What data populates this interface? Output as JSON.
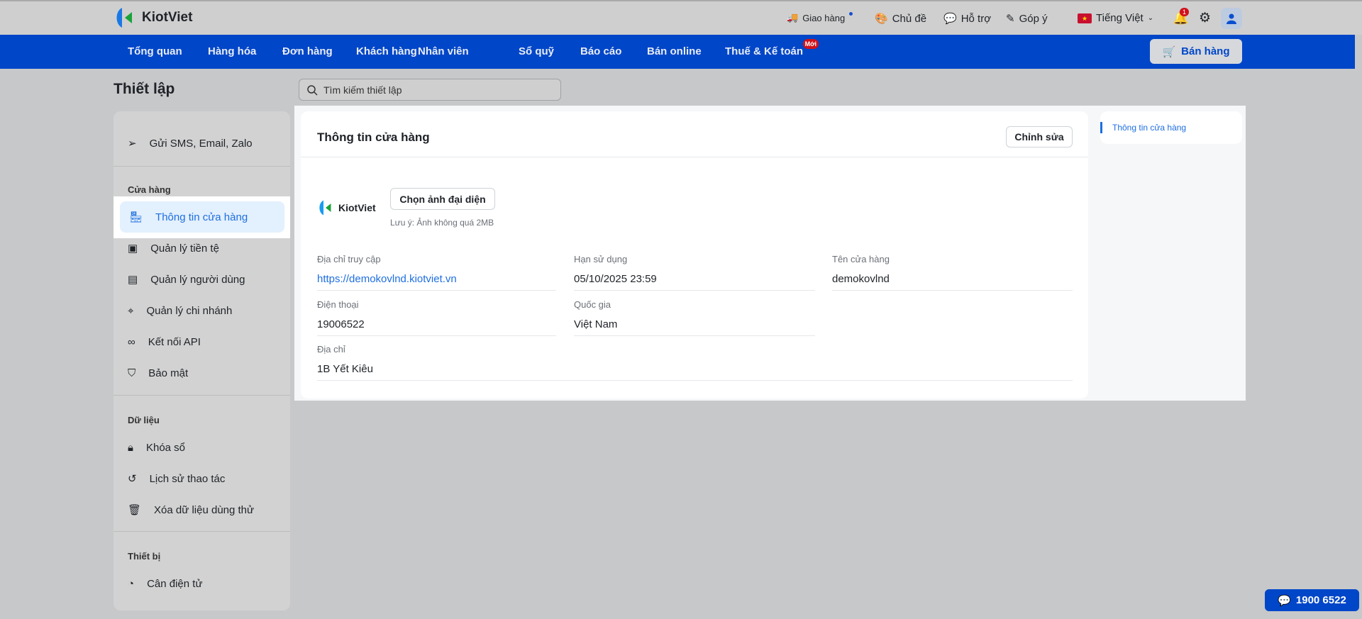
{
  "header": {
    "brand": "KiotViet",
    "delivery": "Giao hàng",
    "theme": "Chủ đề",
    "support": "Hỗ trợ",
    "feedback": "Góp ý",
    "language": "Tiếng Việt",
    "notification_count": "1"
  },
  "nav": {
    "items": [
      "Tổng quan",
      "Hàng hóa",
      "Đơn hàng",
      "Khách hàng",
      "Nhân viên",
      "Sổ quỹ",
      "Báo cáo",
      "Bán online",
      "Thuế & Kế toán"
    ],
    "new_badge": "Mới",
    "sell_button": "Bán hàng"
  },
  "page": {
    "title": "Thiết lập",
    "search_placeholder": "Tìm kiếm thiết lập"
  },
  "sidebar": {
    "top_item": "Gửi SMS, Email, Zalo",
    "store_section": "Cửa hàng",
    "store_items": [
      "Thông tin cửa hàng",
      "Quản lý tiền tệ",
      "Quản lý người dùng",
      "Quản lý chi nhánh",
      "Kết nối API",
      "Bảo mật"
    ],
    "data_section": "Dữ liệu",
    "data_items": [
      "Khóa sổ",
      "Lịch sử thao tác",
      "Xóa dữ liệu dùng thử"
    ],
    "device_section": "Thiết bị",
    "device_items": [
      "Cân điện tử"
    ]
  },
  "card": {
    "title": "Thông tin cửa hàng",
    "edit_button": "Chỉnh sửa",
    "logo_text": "KiotViet",
    "choose_avatar": "Chọn ảnh đại diện",
    "note": "Lưu ý: Ảnh không quá 2MB",
    "fields": [
      {
        "label": "Địa chỉ truy cập",
        "value": "https://demokovlnd.kiotviet.vn"
      },
      {
        "label": "Hạn sử dụng",
        "value": "05/10/2025 23:59"
      },
      {
        "label": "Tên cửa hàng",
        "value": "demokovlnd"
      },
      {
        "label": "Điện thoại",
        "value": "19006522"
      },
      {
        "label": "Quốc gia",
        "value": "Việt Nam"
      },
      {
        "label": "Địa chỉ",
        "value": "1B Yết Kiêu"
      }
    ]
  },
  "toc": {
    "items": [
      "Thông tin cửa hàng"
    ]
  },
  "hotline": "1900 6522",
  "colors": {
    "brand_blue": "#0046c8",
    "link": "#1f6fe0",
    "badge_red": "#d0121b"
  }
}
